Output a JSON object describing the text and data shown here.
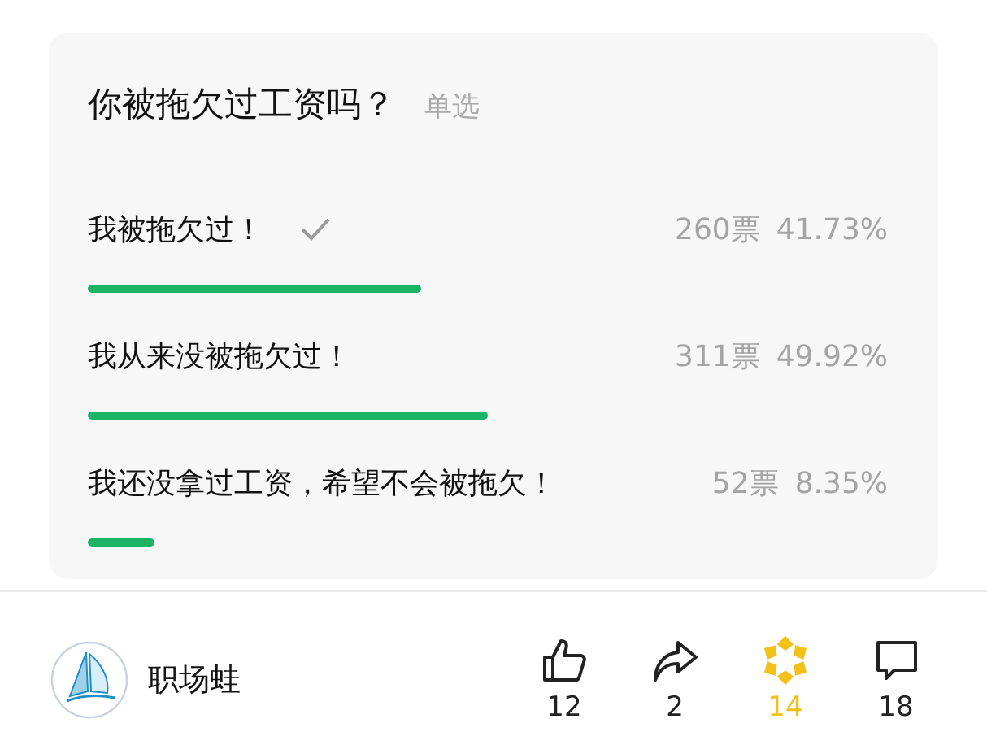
{
  "poll": {
    "question": "你被拖欠过工资吗？",
    "mode": "单选",
    "options": [
      {
        "label": "我被拖欠过！",
        "selected": true,
        "votes": "260票",
        "percent": "41.73%"
      },
      {
        "label": "我从来没被拖欠过！",
        "selected": false,
        "votes": "311票",
        "percent": "49.92%"
      },
      {
        "label": "我还没拿过工资，希望不会被拖欠！",
        "selected": false,
        "votes": "52票",
        "percent": "8.35%"
      }
    ]
  },
  "footer": {
    "author": "职场蛙",
    "actions": [
      {
        "kind": "like",
        "count": "12",
        "on": false
      },
      {
        "kind": "share",
        "count": "2",
        "on": false
      },
      {
        "kind": "favorite",
        "count": "14",
        "on": true
      },
      {
        "kind": "comment",
        "count": "18",
        "on": false
      }
    ]
  }
}
